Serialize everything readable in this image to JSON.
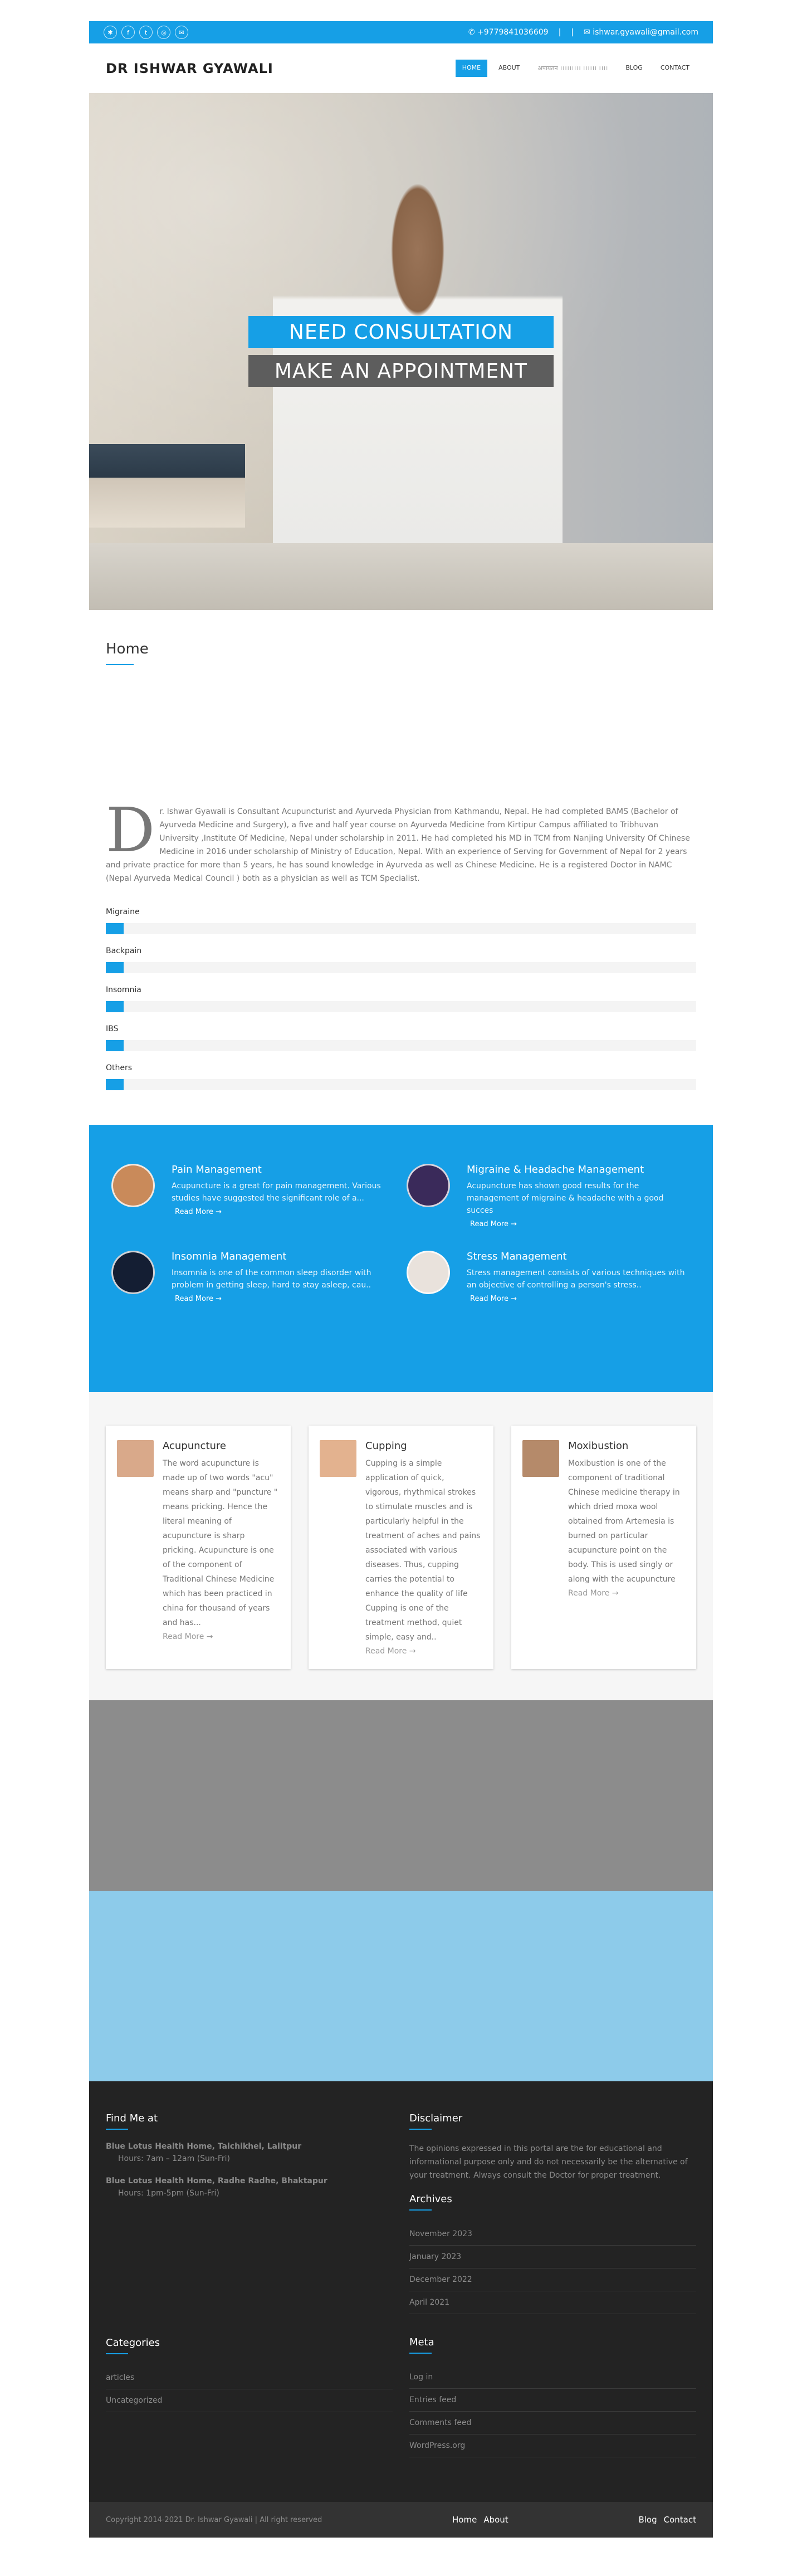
{
  "topbar": {
    "phone": "+9779841036609",
    "separator": "|",
    "email": "ishwar.gyawali@gmail.com",
    "socials": [
      {
        "icon": "yelp-icon",
        "glyph": "✱"
      },
      {
        "icon": "facebook-icon",
        "glyph": "f"
      },
      {
        "icon": "twitter-icon",
        "glyph": "t"
      },
      {
        "icon": "instagram-icon",
        "glyph": "◎"
      },
      {
        "icon": "email-icon",
        "glyph": "✉"
      }
    ],
    "phone_glyph": "✆",
    "email_glyph": "✉"
  },
  "header": {
    "brand": "DR ISHWAR GYAWALI",
    "menu": [
      "HOME",
      "ABOUT",
      "अपायतन ।।।।।।।।। ।।।।।। ।।।।",
      "BLOG",
      "CONTACT"
    ]
  },
  "hero": {
    "cta_primary": "NEED CONSULTATION",
    "cta_secondary": "MAKE AN APPOINTMENT"
  },
  "home": {
    "title": "Home",
    "dropcap": "D",
    "about": "r. Ishwar Gyawali is Consultant Acupuncturist and Ayurveda Physician from Kathmandu, Nepal. He had completed BAMS (Bachelor of Ayurveda Medicine and Surgery), a five and half year course on Ayurveda Medicine from Kirtipur Campus affiliated to Tribhuvan University ,Institute Of Medicine, Nepal under scholarship in 2011. He had completed his MD in TCM from Nanjing University Of Chinese Medicine in 2016 under scholarship of Ministry of Education, Nepal. With an experience of Serving for Government of Nepal for 2 years and private practice for more than 5 years, he has sound knowledge in Ayurveda as well as Chinese Medicine. He is a registered Doctor in NAMC (Nepal Ayurveda Medical Council ) both as a physician as well as TCM Specialist."
  },
  "skills": [
    {
      "label": "Migraine",
      "level": 0.03
    },
    {
      "label": "Backpain",
      "level": 0.03
    },
    {
      "label": "Insomnia",
      "level": 0.03
    },
    {
      "label": "IBS",
      "level": 0.03
    },
    {
      "label": "Others",
      "level": 0.03
    }
  ],
  "services": [
    {
      "title": "Pain Management",
      "text": "Acupuncture is a great for pain management. Various studies have suggested the significant role of a...",
      "more": "Read More →",
      "color": "#c98a5a"
    },
    {
      "title": "Migraine & Headache Management",
      "text": "Acupuncture has shown good results for the management of migraine & headache with a good succes",
      "more": "Read More →",
      "color": "#3a2a5a"
    },
    {
      "title": "Insomnia Management",
      "text": "Insomnia is one of the common sleep disorder with problem in getting sleep, hard to stay asleep, cau..",
      "more": "Read More →",
      "color": "#141e33"
    },
    {
      "title": "Stress Management",
      "text": "Stress management consists of various techniques with an objective of controlling a person's stress..",
      "more": "Read More →",
      "color": "#e9e2dc"
    }
  ],
  "therapies": [
    {
      "title": "Acupuncture",
      "text": "The word acupuncture is made up of two words \"acu\" means sharp and \"puncture \" means pricking. Hence the literal meaning of acupuncture is sharp pricking. Acupuncture is one of the component of Traditional Chinese Medicine which has been practiced in china for thousand of years and has...",
      "more": "Read More →",
      "color": "#d9a98a"
    },
    {
      "title": "Cupping",
      "text": "Cupping is a simple application of quick, vigorous, rhythmical strokes to stimulate muscles and is particularly helpful in the treatment of aches and pains associated with various diseases. Thus, cupping carries the potential to enhance the quality of life Cupping is one of the treatment method, quiet simple, easy and..",
      "more": "Read More →",
      "color": "#e3b28f"
    },
    {
      "title": "Moxibustion",
      "text": "Moxibustion is one of the component of traditional Chinese medicine therapy in which dried moxa wool obtained from Artemesia is burned on particular acupuncture point on the body. This is used singly or along with the acupuncture",
      "more": "Read More →",
      "color": "#b58a6a"
    }
  ],
  "footer": {
    "find_title": "Find Me at",
    "locations": [
      {
        "name": "Blue Lotus Health Home, Talchikhel, Lalitpur",
        "hours": "Hours: 7am – 12am (Sun-Fri)"
      },
      {
        "name": "Blue Lotus Health Home, Radhe Radhe, Bhaktapur",
        "hours": "Hours: 1pm-5pm (Sun-Fri)"
      }
    ],
    "disclaimer_title": "Disclaimer",
    "disclaimer_text": "The opinions expressed in this portal are the for educational and informational purpose only and do not necessarily be the alternative of  your treatment.  Always consult the Doctor for proper treatment.",
    "archives_title": "Archives",
    "archives": [
      "November 2023",
      "January 2023",
      "December 2022",
      "April 2021"
    ],
    "categories_title": "Categories",
    "categories": [
      "articles",
      "Uncategorized"
    ],
    "meta_title": "Meta",
    "meta": [
      "Log in",
      "Entries feed",
      "Comments feed",
      "WordPress.org"
    ]
  },
  "bottom": {
    "copyright": "Copyright 2014-2021 Dr. Ishwar Gyawali | All right reserved",
    "links_left": [
      "Home",
      "About"
    ],
    "links_right": [
      "Blog",
      "Contact"
    ]
  },
  "colors": {
    "accent": "#169fe6",
    "dark": "#232323"
  }
}
